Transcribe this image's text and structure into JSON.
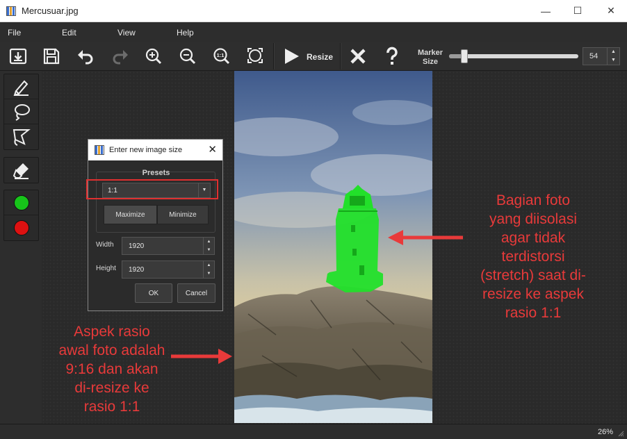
{
  "window": {
    "title": "Mercusuar.jpg",
    "minimize_glyph": "—",
    "maximize_glyph": "☐",
    "close_glyph": "✕"
  },
  "menu": [
    "File",
    "Edit",
    "View",
    "Help"
  ],
  "toolbar": {
    "icons": [
      "open-icon",
      "save-icon",
      "undo-icon",
      "redo-icon",
      "zoom-in-icon",
      "zoom-out-icon",
      "zoom-1-1-icon",
      "fit-screen-icon"
    ],
    "zoom_1_1_label": "1:1",
    "resize_label": "Resize",
    "marker_size_label": "Marker Size",
    "marker_size_value": "54",
    "marker_slider_fraction": 0.12,
    "spin_up_glyph": "▲",
    "spin_down_glyph": "▼"
  },
  "tools": {
    "selection": [
      "brush-icon",
      "lasso-icon",
      "polygon-lasso-icon"
    ],
    "eraser": "eraser-icon",
    "colors": [
      {
        "name": "keep-color",
        "color": "#17c41a"
      },
      {
        "name": "remove-color",
        "color": "#dd1111"
      }
    ]
  },
  "dialog": {
    "title": "Enter new image size",
    "close_glyph": "✕",
    "presets_label": "Presets",
    "preset_value": "1:1",
    "dropdown_glyph": "▼",
    "maximize_label": "Maximize",
    "minimize_label": "Minimize",
    "width_label": "Width",
    "width_value": "1920",
    "height_label": "Height",
    "height_value": "1920",
    "spin_up_glyph": "▲",
    "spin_down_glyph": "▼",
    "ok_label": "OK",
    "cancel_label": "Cancel"
  },
  "annotations": {
    "left_note_lines": [
      "Aspek rasio",
      "awal foto adalah",
      "9:16 dan akan",
      "di-resize ke",
      "rasio 1:1"
    ],
    "right_note_lines": [
      "Bagian foto",
      "yang diisolasi",
      "agar tidak",
      "terdistorsi",
      "(stretch) saat di-",
      "resize ke aspek",
      "rasio 1:1"
    ],
    "accent_color": "#e83a3a"
  },
  "status": {
    "zoom": "26%"
  }
}
